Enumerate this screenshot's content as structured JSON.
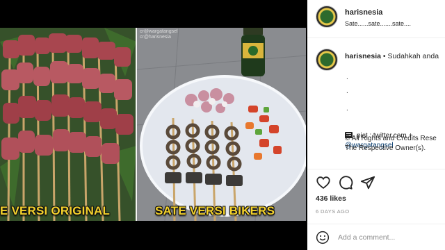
{
  "post": {
    "watermark_line1": "cr@wargatangsel",
    "watermark_line2": "cr@harisnesia",
    "caption_left": "E VERSI ORIGINAL",
    "caption_right": "SATE VERSI BIKERS"
  },
  "header": {
    "username": "harisnesia",
    "subline": "Sate......sate.......sate...."
  },
  "comment": {
    "username": "harisnesia",
    "text": " • Sudahkah anda",
    "dots": [
      ".",
      ".",
      "."
    ],
    "pict": "pict : twitter.com +",
    "mention": "@wargatangsel",
    "rights_line1": "© All Rights and Credits Rese",
    "rights_line2": "The Respective Owner(s)."
  },
  "actions": {
    "likes": "436 likes",
    "date": "6 DAYS AGO"
  },
  "add_comment": {
    "placeholder": "Add a comment..."
  },
  "icons": {
    "like": "heart-icon",
    "comment": "comment-icon",
    "share": "share-icon",
    "emoji": "smile-icon"
  },
  "colors": {
    "caption_yellow": "#f4d22c",
    "mention_blue": "#00376b",
    "meta_gray": "#8e8e8e"
  }
}
